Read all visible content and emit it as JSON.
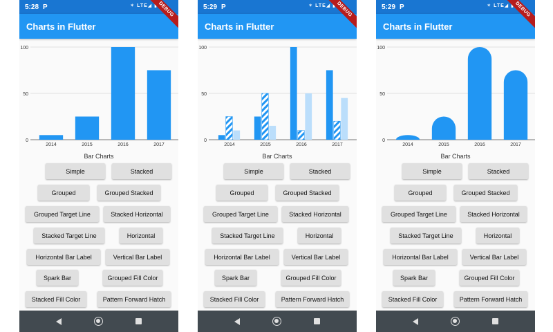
{
  "status_bar": {
    "times": [
      "5:28",
      "5:29",
      "5:29"
    ],
    "carrier_icon": "P",
    "sys_icons": "✶ LTE◢ ▮"
  },
  "app": {
    "title": "Charts in Flutter",
    "debug_label": "DEBUG",
    "chart_caption": "Bar Charts"
  },
  "buttons": [
    "Simple",
    "Stacked",
    "Grouped",
    "Grouped Stacked",
    "Grouped Target Line",
    "Stacked Horizontal",
    "Stacked Target Line",
    "Horizontal",
    "Horizontal Bar Label",
    "Vertical Bar Label",
    "Spark Bar",
    "Grouped Fill Color",
    "Stacked Fill Color",
    "Pattern Forward Hatch"
  ],
  "nav_icons": [
    "back-icon",
    "home-icon",
    "recent-apps-icon"
  ],
  "colors": {
    "status": "#1976d2",
    "appbar": "#2196f3",
    "bar_primary": "#2196f3",
    "bar_light": "#bbdefb",
    "navbar": "#424a50"
  },
  "chart_data": [
    {
      "type": "bar",
      "categories": [
        "2014",
        "2015",
        "2016",
        "2017"
      ],
      "series": [
        {
          "values": [
            5,
            25,
            100,
            75
          ]
        }
      ],
      "yticks": [
        "0",
        "50",
        "100"
      ],
      "ylim": [
        0,
        100
      ],
      "grid": true
    },
    {
      "type": "bar",
      "categories": [
        "2014",
        "2015",
        "2016",
        "2017"
      ],
      "series": [
        {
          "values": [
            5,
            25,
            100,
            75
          ],
          "style": "solid"
        },
        {
          "values": [
            25,
            50,
            10,
            20
          ],
          "style": "hatch"
        },
        {
          "values": [
            10,
            15,
            50,
            45
          ],
          "style": "light"
        }
      ],
      "yticks": [
        "0",
        "50",
        "100"
      ],
      "ylim": [
        0,
        100
      ],
      "grid": true
    },
    {
      "type": "bar",
      "categories": [
        "2014",
        "2015",
        "2016",
        "2017"
      ],
      "series": [
        {
          "values": [
            5,
            25,
            100,
            75
          ],
          "style": "rounded"
        }
      ],
      "yticks": [
        "0",
        "50",
        "100"
      ],
      "ylim": [
        0,
        100
      ],
      "grid": true
    }
  ]
}
